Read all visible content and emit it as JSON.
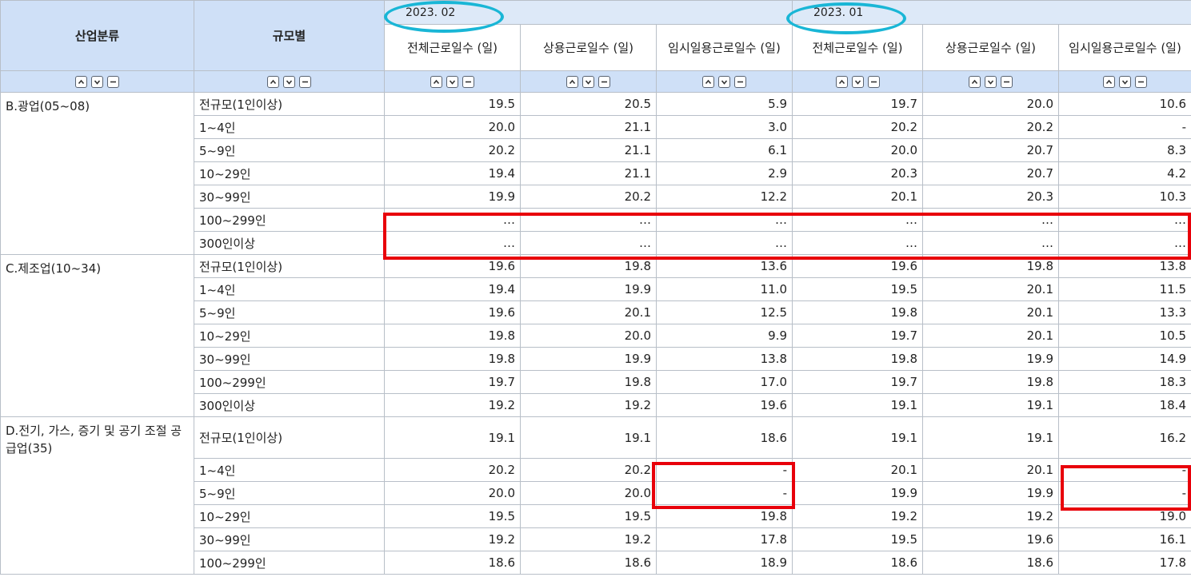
{
  "headers": {
    "industry": "산업분류",
    "size": "규모별",
    "period_feb": "2023. 02",
    "period_jan": "2023. 01",
    "metrics": [
      "전체근로일수 (일)",
      "상용근로일수 (일)",
      "임시일용근로일수 (일)"
    ]
  },
  "rows": [
    {
      "cat": "B.광업(05~08)",
      "size": "전규모(1인이상)",
      "feb": [
        "19.5",
        "20.5",
        "5.9"
      ],
      "jan": [
        "19.7",
        "20.0",
        "10.6"
      ]
    },
    {
      "cat": "",
      "size": "1~4인",
      "feb": [
        "20.0",
        "21.1",
        "3.0"
      ],
      "jan": [
        "20.2",
        "20.2",
        "-"
      ]
    },
    {
      "cat": "",
      "size": "5~9인",
      "feb": [
        "20.2",
        "21.1",
        "6.1"
      ],
      "jan": [
        "20.0",
        "20.7",
        "8.3"
      ]
    },
    {
      "cat": "",
      "size": "10~29인",
      "feb": [
        "19.4",
        "21.1",
        "2.9"
      ],
      "jan": [
        "20.3",
        "20.7",
        "4.2"
      ]
    },
    {
      "cat": "",
      "size": "30~99인",
      "feb": [
        "19.9",
        "20.2",
        "12.2"
      ],
      "jan": [
        "20.1",
        "20.3",
        "10.3"
      ]
    },
    {
      "cat": "",
      "size": "100~299인",
      "feb": [
        "…",
        "…",
        "…"
      ],
      "jan": [
        "…",
        "…",
        "…"
      ]
    },
    {
      "cat": "",
      "size": "300인이상",
      "feb": [
        "…",
        "…",
        "…"
      ],
      "jan": [
        "…",
        "…",
        "…"
      ]
    },
    {
      "cat": "C.제조업(10~34)",
      "size": "전규모(1인이상)",
      "feb": [
        "19.6",
        "19.8",
        "13.6"
      ],
      "jan": [
        "19.6",
        "19.8",
        "13.8"
      ]
    },
    {
      "cat": "",
      "size": "1~4인",
      "feb": [
        "19.4",
        "19.9",
        "11.0"
      ],
      "jan": [
        "19.5",
        "20.1",
        "11.5"
      ]
    },
    {
      "cat": "",
      "size": "5~9인",
      "feb": [
        "19.6",
        "20.1",
        "12.5"
      ],
      "jan": [
        "19.8",
        "20.1",
        "13.3"
      ]
    },
    {
      "cat": "",
      "size": "10~29인",
      "feb": [
        "19.8",
        "20.0",
        "9.9"
      ],
      "jan": [
        "19.7",
        "20.1",
        "10.5"
      ]
    },
    {
      "cat": "",
      "size": "30~99인",
      "feb": [
        "19.8",
        "19.9",
        "13.8"
      ],
      "jan": [
        "19.8",
        "19.9",
        "14.9"
      ]
    },
    {
      "cat": "",
      "size": "100~299인",
      "feb": [
        "19.7",
        "19.8",
        "17.0"
      ],
      "jan": [
        "19.7",
        "19.8",
        "18.3"
      ]
    },
    {
      "cat": "",
      "size": "300인이상",
      "feb": [
        "19.2",
        "19.2",
        "19.6"
      ],
      "jan": [
        "19.1",
        "19.1",
        "18.4"
      ]
    },
    {
      "cat": "D.전기, 가스, 증기 및 공기 조절 공급업(35)",
      "size": "전규모(1인이상)",
      "feb": [
        "19.1",
        "19.1",
        "18.6"
      ],
      "jan": [
        "19.1",
        "19.1",
        "16.2"
      ]
    },
    {
      "cat": "",
      "size": "1~4인",
      "feb": [
        "20.2",
        "20.2",
        "-"
      ],
      "jan": [
        "20.1",
        "20.1",
        "-"
      ]
    },
    {
      "cat": "",
      "size": "5~9인",
      "feb": [
        "20.0",
        "20.0",
        "-"
      ],
      "jan": [
        "19.9",
        "19.9",
        "-"
      ]
    },
    {
      "cat": "",
      "size": "10~29인",
      "feb": [
        "19.5",
        "19.5",
        "19.8"
      ],
      "jan": [
        "19.2",
        "19.2",
        "19.0"
      ]
    },
    {
      "cat": "",
      "size": "30~99인",
      "feb": [
        "19.2",
        "19.2",
        "17.8"
      ],
      "jan": [
        "19.5",
        "19.6",
        "16.1"
      ]
    },
    {
      "cat": "",
      "size": "100~299인",
      "feb": [
        "18.6",
        "18.6",
        "18.9"
      ],
      "jan": [
        "18.6",
        "18.6",
        "17.8"
      ]
    }
  ],
  "colors": {
    "header_bg": "#cfe0f7",
    "highlight_red": "#e8000a",
    "highlight_cyan": "#19b6d6"
  }
}
